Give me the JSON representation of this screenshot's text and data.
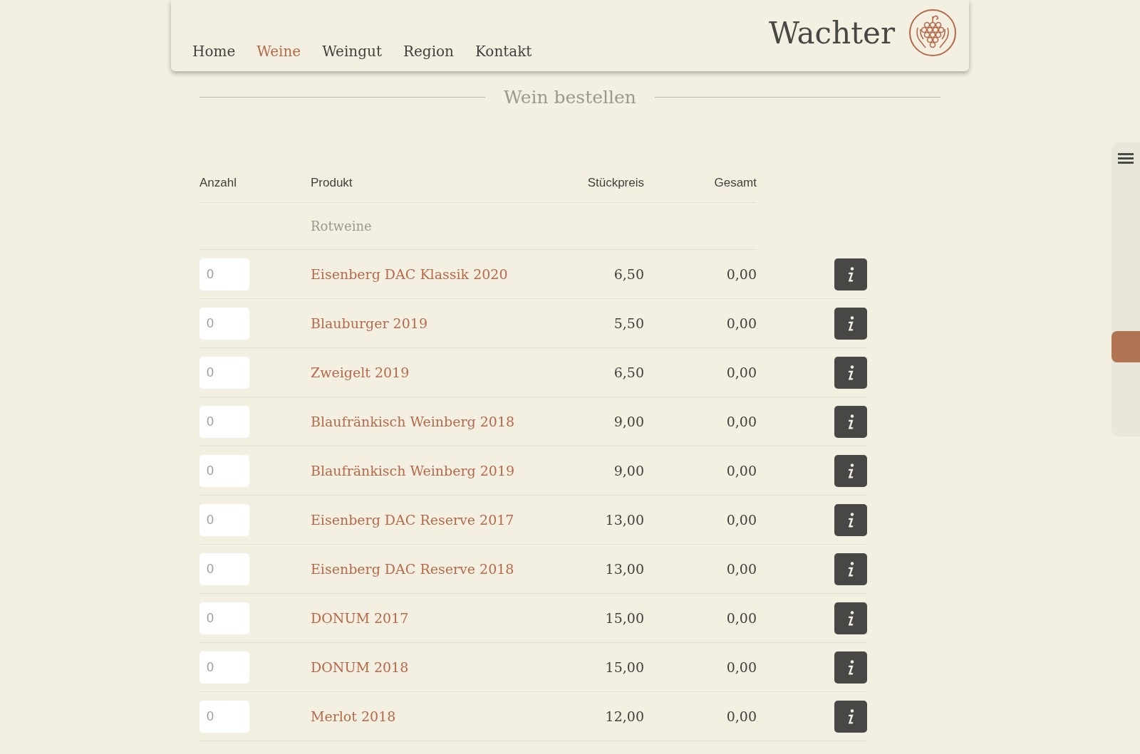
{
  "nav": {
    "items": [
      {
        "label": "Home",
        "selected": false
      },
      {
        "label": "Weine",
        "selected": true
      },
      {
        "label": "Weingut",
        "selected": false
      },
      {
        "label": "Region",
        "selected": false
      },
      {
        "label": "Kontakt",
        "selected": false
      }
    ],
    "brand": "Wachter"
  },
  "title": "Wein bestellen",
  "table": {
    "columns": [
      "Anzahl",
      "Produkt",
      "Stückpreis",
      "Gesamt"
    ],
    "group": "Rotweine",
    "rows": [
      {
        "placeholder": "0",
        "product": "Eisenberg DAC Klassik 2020",
        "price": "6,50",
        "total": "0,00"
      },
      {
        "placeholder": "0",
        "product": "Blauburger 2019",
        "price": "5,50",
        "total": "0,00"
      },
      {
        "placeholder": "0",
        "product": "Zweigelt 2019",
        "price": "6,50",
        "total": "0,00"
      },
      {
        "placeholder": "0",
        "product": "Blaufränkisch Weinberg 2018",
        "price": "9,00",
        "total": "0,00"
      },
      {
        "placeholder": "0",
        "product": "Blaufränkisch Weinberg 2019",
        "price": "9,00",
        "total": "0,00"
      },
      {
        "placeholder": "0",
        "product": "Eisenberg DAC Reserve 2017",
        "price": "13,00",
        "total": "0,00"
      },
      {
        "placeholder": "0",
        "product": "Eisenberg DAC Reserve 2018",
        "price": "13,00",
        "total": "0,00"
      },
      {
        "placeholder": "0",
        "product": "DONUM 2017",
        "price": "15,00",
        "total": "0,00"
      },
      {
        "placeholder": "0",
        "product": "DONUM 2018",
        "price": "15,00",
        "total": "0,00"
      },
      {
        "placeholder": "0",
        "product": "Merlot 2018",
        "price": "12,00",
        "total": "0,00"
      }
    ]
  }
}
